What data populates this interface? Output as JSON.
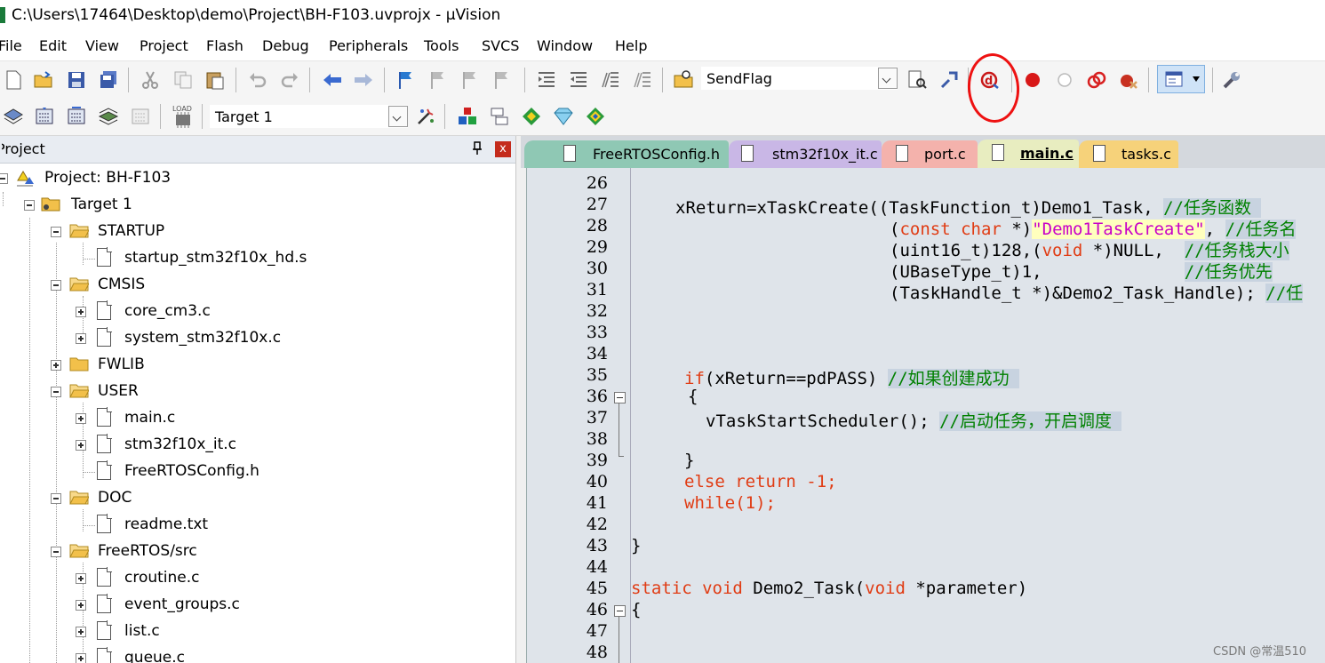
{
  "window": {
    "title": "C:\\Users\\17464\\Desktop\\demo\\Project\\BH-F103.uvprojx - µVision"
  },
  "menu": [
    "File",
    "Edit",
    "View",
    "Project",
    "Flash",
    "Debug",
    "Peripherals",
    "Tools",
    "SVCS",
    "Window",
    "Help"
  ],
  "toolbar1": {
    "find_combo": "SendFlag"
  },
  "toolbar2": {
    "target_combo": "Target 1",
    "load_label": "LOAD"
  },
  "project_panel": {
    "header": "Project",
    "close": "x",
    "tree": [
      {
        "label": "Project: BH-F103"
      },
      {
        "label": "Target 1"
      },
      {
        "label": "STARTUP"
      },
      {
        "label": "startup_stm32f10x_hd.s"
      },
      {
        "label": "CMSIS"
      },
      {
        "label": "core_cm3.c"
      },
      {
        "label": "system_stm32f10x.c"
      },
      {
        "label": "FWLIB"
      },
      {
        "label": "USER"
      },
      {
        "label": "main.c"
      },
      {
        "label": "stm32f10x_it.c"
      },
      {
        "label": "FreeRTOSConfig.h"
      },
      {
        "label": "DOC"
      },
      {
        "label": "readme.txt"
      },
      {
        "label": "FreeRTOS/src"
      },
      {
        "label": "croutine.c"
      },
      {
        "label": "event_groups.c"
      },
      {
        "label": "list.c"
      },
      {
        "label": "queue.c"
      }
    ]
  },
  "tabs": [
    {
      "label": "FreeRTOSConfig.h",
      "color": "#8fc8b4"
    },
    {
      "label": "stm32f10x_it.c",
      "color": "#c9b7e6"
    },
    {
      "label": "port.c",
      "color": "#f4b2ac"
    },
    {
      "label": "main.c",
      "color": "#e8edc0",
      "active": true
    },
    {
      "label": "tasks.c",
      "color": "#f6d27a"
    }
  ],
  "editor": {
    "line_numbers": [
      "26",
      "27",
      "28",
      "29",
      "30",
      "31",
      "32",
      "33",
      "34",
      "35",
      "36",
      "37",
      "38",
      "39",
      "40",
      "41",
      "42",
      "43",
      "44",
      "45",
      "46",
      "47",
      "48"
    ],
    "code": {
      "l27_a": "xReturn=xTaskCreate((TaskFunction_t)Demo1_Task, ",
      "l27_c": "//任务函数 ",
      "l28_a": "(const char *)",
      "l28_s": "\"Demo1TaskCreate\"",
      "l28_b": ", ",
      "l28_c": "//任务名",
      "l29_a": "(uint16_t)128,(void *)NULL,  ",
      "l29_c": "//任务栈大小",
      "l30_a": "(UBaseType_t)1,              ",
      "l30_c": "//任务优先",
      "l31_a": "(TaskHandle_t *)&Demo2_Task_Handle); ",
      "l31_c": "//任",
      "l35_a": "if(xReturn==pdPASS) ",
      "l35_c": "//如果创建成功 ",
      "l36": "{",
      "l37_a": "vTaskStartScheduler(); ",
      "l37_c": "//启动任务，开启调度 ",
      "l39": "}",
      "l40": "else return -1;",
      "l41": "while(1);",
      "l43": "}",
      "l45": "static void Demo2_Task(void *parameter)",
      "l46": "{"
    }
  },
  "watermark": "CSDN @常温510"
}
